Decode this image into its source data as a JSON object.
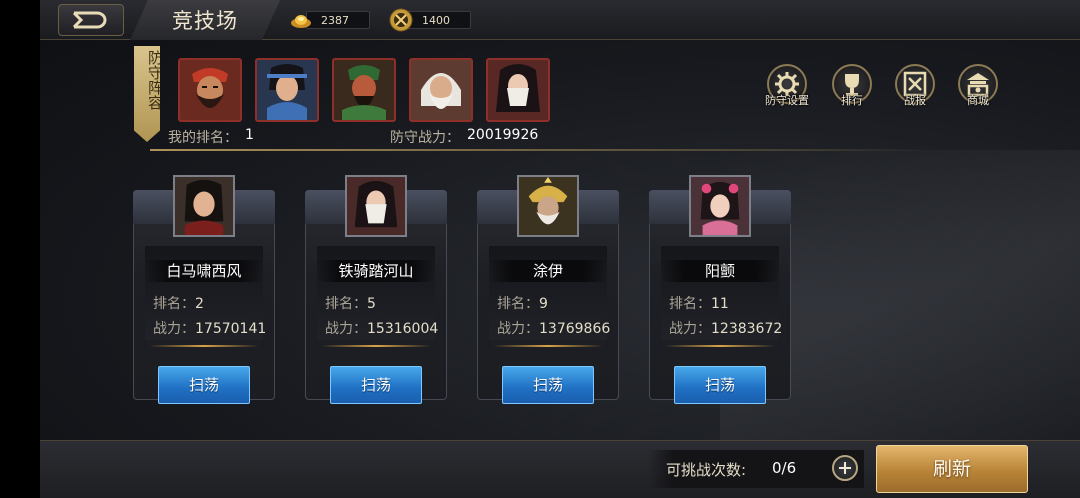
{
  "header": {
    "title": "竞技场",
    "gold_amount": "2387",
    "honor_amount": "1400"
  },
  "defense": {
    "banner_label": "防守阵容",
    "my_rank_label": "我的排名：",
    "my_rank_value": "1",
    "power_label": "防守战力：",
    "power_value": "20019926",
    "heroes": [
      "red-bearded-general",
      "blue-armored-warrior",
      "green-robed-general",
      "white-haired-sage",
      "veiled-lady"
    ]
  },
  "menu": {
    "defense_settings": "防守设置",
    "ranking": "排行",
    "battle_report": "战报",
    "shop": "商城"
  },
  "opponents": [
    {
      "name": "白马啸西风",
      "rank_label": "排名：",
      "rank": "2",
      "power_label": "战力：",
      "power": "17570141",
      "button": "扫荡"
    },
    {
      "name": "铁骑踏河山",
      "rank_label": "排名：",
      "rank": "5",
      "power_label": "战力：",
      "power": "15316004",
      "button": "扫荡"
    },
    {
      "name": "涂伊",
      "rank_label": "排名：",
      "rank": "9",
      "power_label": "战力：",
      "power": "13769866",
      "button": "扫荡"
    },
    {
      "name": "阳颤",
      "rank_label": "排名：",
      "rank": "11",
      "power_label": "战力：",
      "power": "12383672",
      "button": "扫荡"
    }
  ],
  "footer": {
    "attempts_label": "可挑战次数:",
    "attempts_value": "0/6",
    "refresh_label": "刷新"
  },
  "colors": {
    "accent_gold": "#d7a347",
    "sweep_blue": "#1f6fc3",
    "refresh_gold": "#b98437"
  }
}
